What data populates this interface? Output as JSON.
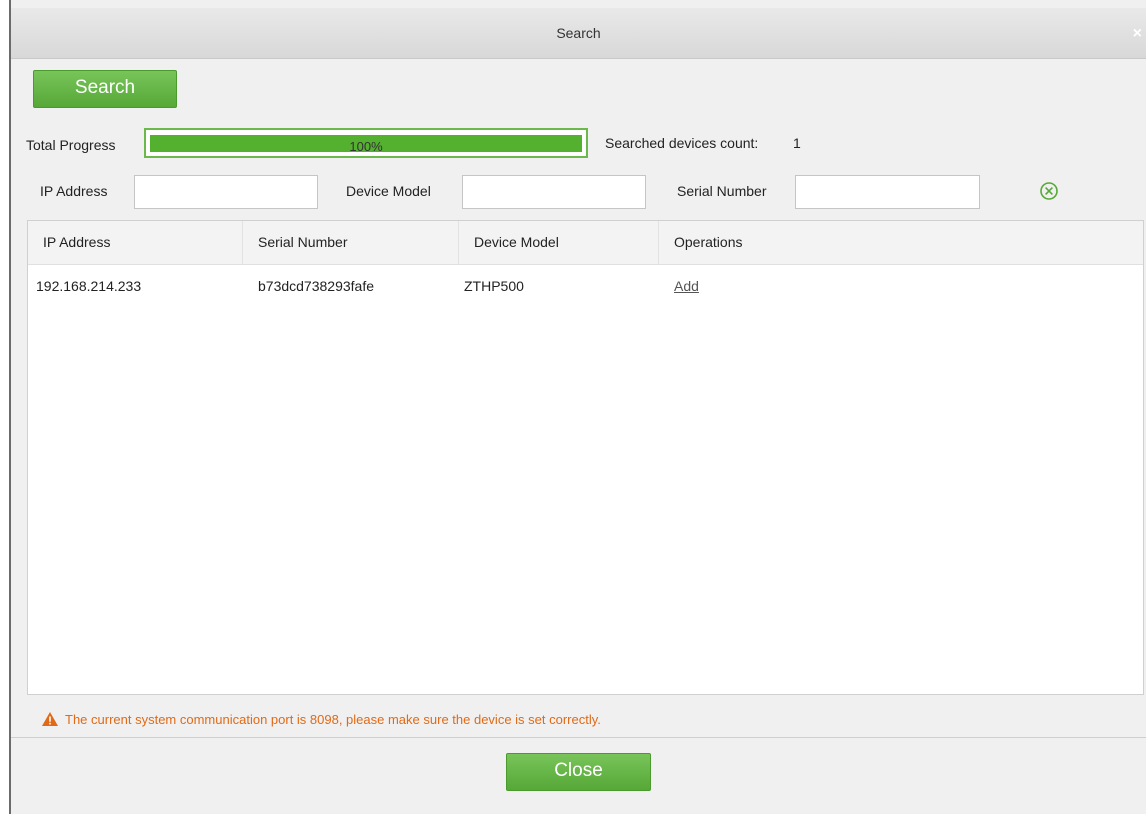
{
  "dialog": {
    "title": "Search",
    "close_glyph": "×"
  },
  "toolbar": {
    "search_label": "Search"
  },
  "progress": {
    "label": "Total Progress",
    "percent": 100,
    "percent_text": "100%",
    "count_label": "Searched devices count:",
    "count_value": "1"
  },
  "filters": {
    "ip_label": "IP Address",
    "ip_value": "",
    "model_label": "Device Model",
    "model_value": "",
    "serial_label": "Serial Number",
    "serial_value": "",
    "clear_icon": "clear-circle-x-icon"
  },
  "table": {
    "headers": [
      "IP Address",
      "Serial Number",
      "Device Model",
      "Operations"
    ],
    "rows": [
      {
        "ip": "192.168.214.233",
        "serial": "b73dcd738293fafe",
        "model": "ZTHP500",
        "operation": "Add"
      }
    ]
  },
  "footer": {
    "warning": "The current system communication port is 8098, please make sure the device is set correctly.",
    "warning_icon": "warning-triangle-icon",
    "close_label": "Close"
  },
  "colors": {
    "accent_green": "#56a837",
    "warning_orange": "#e06a17"
  }
}
